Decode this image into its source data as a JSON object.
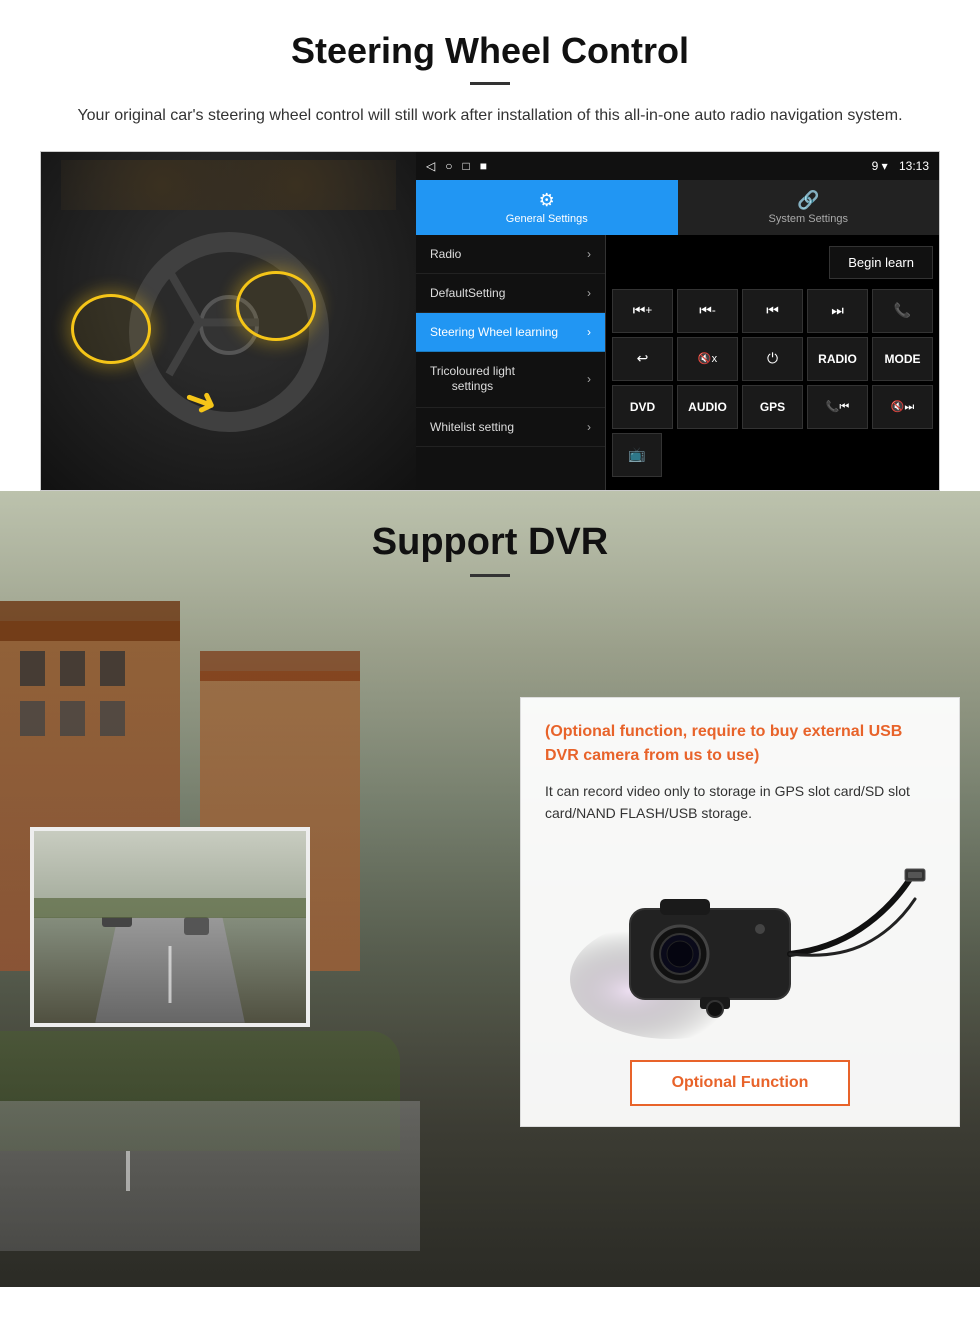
{
  "page": {
    "steering": {
      "title": "Steering Wheel Control",
      "subtitle": "Your original car's steering wheel control will still work after installation of this all-in-one auto radio navigation system.",
      "android": {
        "statusbar": {
          "icons": [
            "◁",
            "○",
            "□",
            "■"
          ],
          "time": "13:13",
          "signal": "9 ▾"
        },
        "tabs": [
          {
            "label": "General Settings",
            "icon": "⚙",
            "active": true
          },
          {
            "label": "System Settings",
            "icon": "🔗",
            "active": false
          }
        ],
        "menu": [
          {
            "label": "Radio",
            "active": false
          },
          {
            "label": "DefaultSetting",
            "active": false
          },
          {
            "label": "Steering Wheel learning",
            "active": true
          },
          {
            "label": "Tricoloured light settings",
            "active": false
          },
          {
            "label": "Whitelist setting",
            "active": false
          }
        ],
        "begin_learn_label": "Begin learn",
        "controls_row1": [
          "⏮+",
          "⏮-",
          "⏮⏮",
          "⏭⏭",
          "📞"
        ],
        "controls_row2": [
          "↩",
          "🔇x",
          "⏻",
          "RADIO",
          "MODE"
        ],
        "controls_row3": [
          "DVD",
          "AUDIO",
          "GPS",
          "📞⏮",
          "🔇⏭"
        ],
        "controls_row4": [
          "📺"
        ]
      }
    },
    "dvr": {
      "title": "Support DVR",
      "info_optional": "(Optional function, require to buy external USB DVR camera from us to use)",
      "info_desc": "It can record video only to storage in GPS slot card/SD slot card/NAND FLASH/USB storage.",
      "optional_btn_label": "Optional Function"
    }
  }
}
